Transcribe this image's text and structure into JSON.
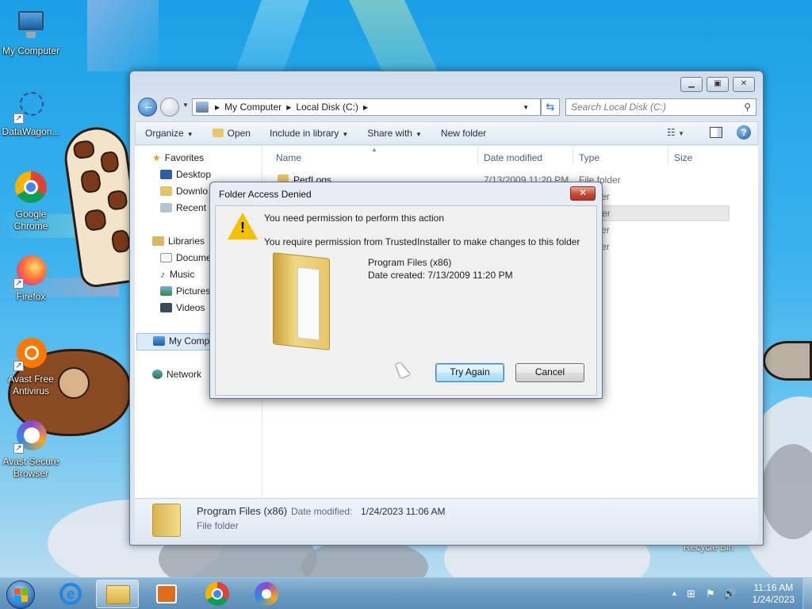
{
  "desktop": {
    "icons": [
      {
        "label": "My Computer"
      },
      {
        "label": "DataWagon..."
      },
      {
        "label": "Google Chrome"
      },
      {
        "label": "Firefox"
      },
      {
        "label": "Avast Free Antivirus"
      },
      {
        "label": "Avast Secure Browser"
      }
    ],
    "recycle_bin": "Recycle Bin"
  },
  "explorer": {
    "address": {
      "segments": [
        "My Computer",
        "Local Disk (C:)"
      ]
    },
    "search_placeholder": "Search Local Disk (C:)",
    "toolbar": {
      "organize": "Organize",
      "open": "Open",
      "include_in_library": "Include in library",
      "share_with": "Share with",
      "new_folder": "New folder"
    },
    "nav": {
      "favorites": "Favorites",
      "desktop": "Desktop",
      "downloads": "Downlo",
      "recent": "Recent P",
      "libraries": "Libraries",
      "documents": "Docume",
      "music": "Music",
      "pictures": "Pictures",
      "videos": "Videos",
      "my_computer": "My Comp",
      "network": "Network"
    },
    "columns": {
      "name": "Name",
      "date_modified": "Date modified",
      "type": "Type",
      "size": "Size"
    },
    "rows": [
      {
        "name": "PerfLogs",
        "date": "7/13/2009 11:20 PM",
        "type": "File folder"
      },
      {
        "type": "older"
      },
      {
        "type": "older"
      },
      {
        "type": "older"
      },
      {
        "type": "older"
      }
    ],
    "details": {
      "name": "Program Files (x86)",
      "modified_label": "Date modified:",
      "modified_value": "1/24/2023 11:06 AM",
      "type": "File folder"
    }
  },
  "dialog": {
    "title": "Folder Access Denied",
    "close_glyph": "✕",
    "message1": "You need permission to perform this action",
    "message2": "You require permission from TrustedInstaller to make changes to this folder",
    "folder_name": "Program Files (x86)",
    "date_created": "Date created: 7/13/2009 11:20 PM",
    "try_again": "Try Again",
    "cancel": "Cancel"
  },
  "taskbar": {
    "time": "11:16 AM",
    "date": "1/24/2023"
  }
}
